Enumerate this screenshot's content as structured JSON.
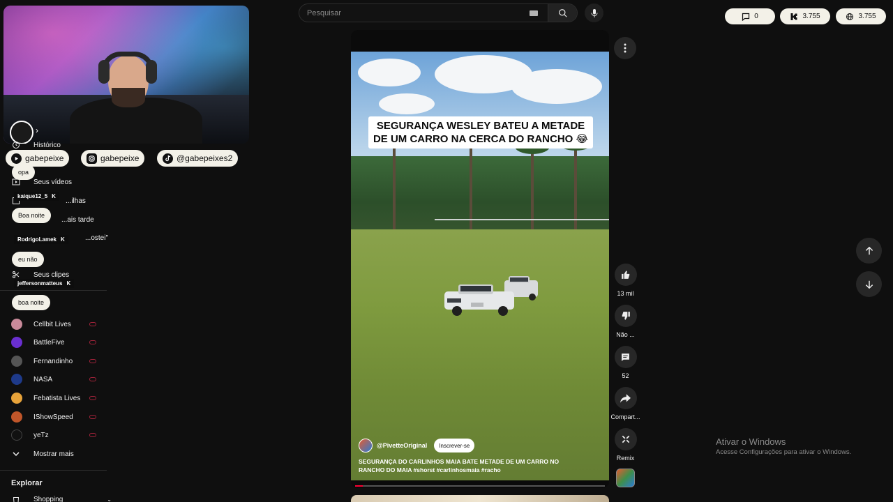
{
  "search": {
    "placeholder": "Pesquisar"
  },
  "counters": {
    "chat_count": "0",
    "kick_count": "3.755",
    "total_count": "3.755"
  },
  "social": {
    "youtube": "gabepeixe",
    "instagram": "gabepeixe",
    "tiktok": "@gabepeixes2"
  },
  "sidebar": {
    "items": [
      {
        "label": "Histórico",
        "icon": "history-icon"
      },
      {
        "label": "Seus vídeos",
        "icon": "video-icon"
      },
      {
        "label": "Assistir mais tarde",
        "icon": "clock-icon"
      },
      {
        "label": "Vídeos com \"Gostei\"",
        "icon": "like-icon"
      },
      {
        "label": "Seus clipes",
        "icon": "scissors-icon"
      }
    ],
    "partial_labels": {
      "playlists": "...ilhas",
      "watch_later": "...ais tarde",
      "liked": "...ostei\""
    },
    "channels": [
      {
        "name": "Cellbit Lives",
        "color": "#c98a9a"
      },
      {
        "name": "BattleFive",
        "color": "#6a2fd0"
      },
      {
        "name": "Fernandinho",
        "color": "#444444"
      },
      {
        "name": "NASA",
        "color": "#1e3a8a"
      },
      {
        "name": "Febatista Lives",
        "color": "#e8a33a"
      },
      {
        "name": "IShowSpeed",
        "color": "#c0562a"
      },
      {
        "name": "yeTz",
        "color": "#111111"
      }
    ],
    "show_more": "Mostrar mais",
    "explore_title": "Explorar",
    "shopping": "Shopping"
  },
  "chat": [
    {
      "type": "msg",
      "text": "opa"
    },
    {
      "type": "user",
      "text": "kaique12_5"
    },
    {
      "type": "msg",
      "text": "Boa noite"
    },
    {
      "type": "user",
      "text": "RodrigoLamek"
    },
    {
      "type": "msg",
      "text": "eu não"
    },
    {
      "type": "user",
      "text": "jeffersonmatteus"
    },
    {
      "type": "msg",
      "text": "boa noite"
    }
  ],
  "short": {
    "headline": "SEGURANÇA WESLEY BATEU A METADE DE UM CARRO NA CERCA DO RANCHO 😂",
    "channel": "@PivetteOriginal",
    "subscribe": "Inscrever-se",
    "caption_prefix": "SEGURANÇA DO CARLINHOS MAIA BATE METADE DE UM CARRO NO RANCHO DO MAIA ",
    "caption_tags": "#shorst #carlinhosmaia #racho",
    "progress": 0.03
  },
  "actions": {
    "likes": "13 mil",
    "dislike": "Não ...",
    "comments": "52",
    "share": "Compart...",
    "remix": "Remix"
  },
  "windows": {
    "title": "Ativar o Windows",
    "subtitle": "Acesse Configurações para ativar o Windows."
  },
  "colors": {
    "accent": "#ff0033",
    "pill_bg": "#f3f1e8",
    "bg": "#0f0f0f"
  }
}
